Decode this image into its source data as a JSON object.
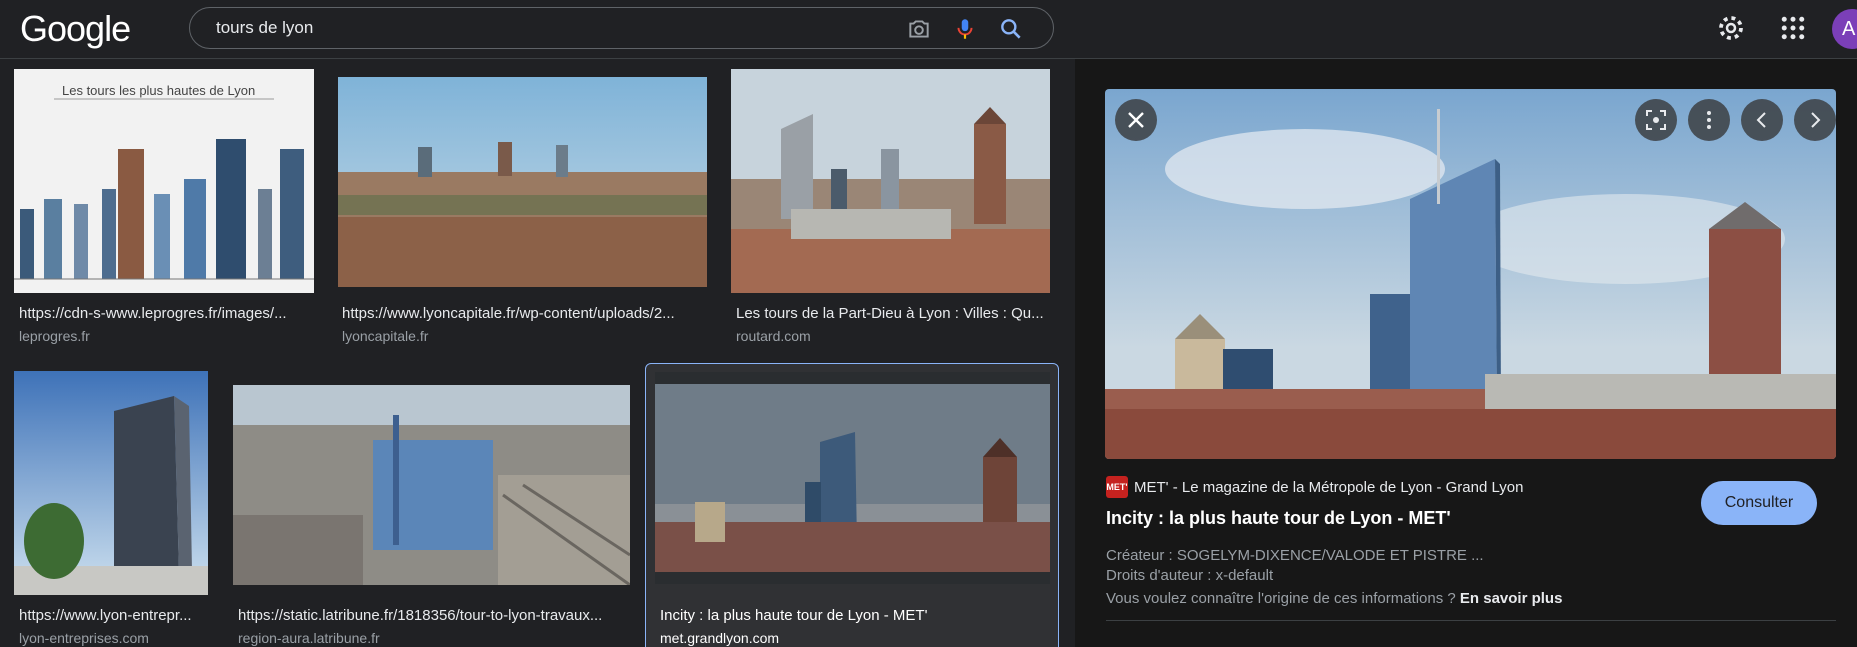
{
  "header": {
    "logo": "Google",
    "search_query": "tours de lyon",
    "avatar_initial": "A"
  },
  "results": [
    {
      "caption": "https://cdn-s-www.leprogres.fr/images/...",
      "source": "leprogres.fr",
      "thumb_title": "Les tours les plus hautes de Lyon"
    },
    {
      "caption": "https://www.lyoncapitale.fr/wp-content/uploads/2...",
      "source": "lyoncapitale.fr"
    },
    {
      "caption": "Les tours de la Part-Dieu à Lyon : Villes : Qu...",
      "source": "routard.com"
    },
    {
      "caption": "https://www.lyon-entrepr...",
      "source": "lyon-entreprises.com"
    },
    {
      "caption": "https://static.latribune.fr/1818356/tour-to-lyon-travaux...",
      "source": "region-aura.latribune.fr"
    },
    {
      "caption": "Incity : la plus haute tour de Lyon - MET'",
      "source": "met.grandlyon.com"
    }
  ],
  "panel": {
    "site_logo_text": "MET'",
    "site_name": "MET' - Le magazine de la Métropole de Lyon - Grand Lyon",
    "title": "Incity : la plus haute tour de Lyon - MET'",
    "consult_label": "Consulter",
    "creator": "Créateur : SOGELYM-DIXENCE/VALODE ET PISTRE ...",
    "rights": "Droits d'auteur : x-default",
    "origin_question": "Vous voulez connaître l'origine de ces informations ?",
    "learn_more": "En savoir plus"
  },
  "colors": {
    "background": "#202124",
    "panel": "#171717",
    "accent": "#8ab4f8",
    "selected_border": "#8ab4f8"
  }
}
